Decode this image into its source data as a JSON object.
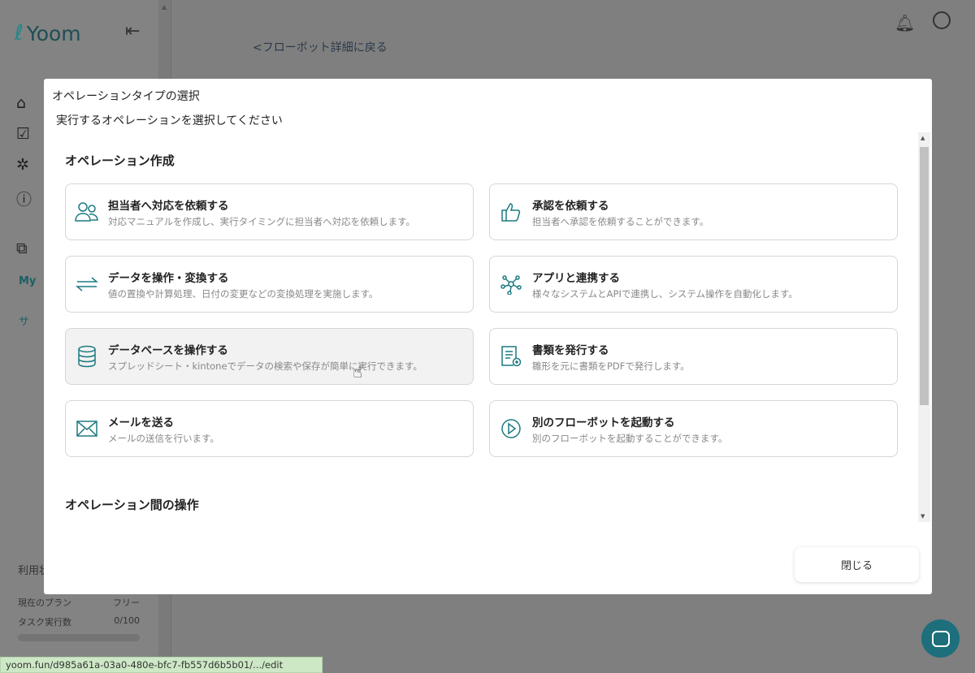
{
  "sidebar": {
    "logo": "Yoom",
    "section_label": "My",
    "sub_label": "サ",
    "usage_title": "利用状",
    "plan_label": "現在のプラン",
    "plan_value": "フリー",
    "tasks_label": "タスク実行数",
    "tasks_value": "0/100",
    "tasks_progress": 0
  },
  "header": {
    "back_link": "<フローボット詳細に戻る"
  },
  "modal": {
    "title": "オペレーションタイプの選択",
    "subtitle": "実行するオペレーションを選択してください",
    "section1": "オペレーション作成",
    "section2": "オペレーション間の操作",
    "cards": [
      {
        "icon": "users-icon",
        "title": "担当者へ対応を依頼する",
        "desc": "対応マニュアルを作成し、実行タイミングに担当者へ対応を依頼します。"
      },
      {
        "icon": "thumbs-up-icon",
        "title": "承認を依頼する",
        "desc": "担当者へ承認を依頼することができます。"
      },
      {
        "icon": "swap-arrows-icon",
        "title": "データを操作・変換する",
        "desc": "値の置換や計算処理、日付の変更などの変換処理を実施します。"
      },
      {
        "icon": "network-icon",
        "title": "アプリと連携する",
        "desc": "様々なシステムとAPIで連携し、システム操作を自動化します。"
      },
      {
        "icon": "database-icon",
        "title": "データベースを操作する",
        "desc": "スプレッドシート・kintoneでデータの検索や保存が簡単に実行できます。"
      },
      {
        "icon": "document-icon",
        "title": "書類を発行する",
        "desc": "雛形を元に書類をPDFで発行します。"
      },
      {
        "icon": "mail-icon",
        "title": "メールを送る",
        "desc": "メールの送信を行います。"
      },
      {
        "icon": "play-circle-icon",
        "title": "別のフローボットを起動する",
        "desc": "別のフローボットを起動することができます。"
      }
    ],
    "close_label": "閉じる"
  },
  "status_url": "yoom.fun/d985a61a-03a0-480e-bfc7-fb557d6b5b01/.../edit"
}
